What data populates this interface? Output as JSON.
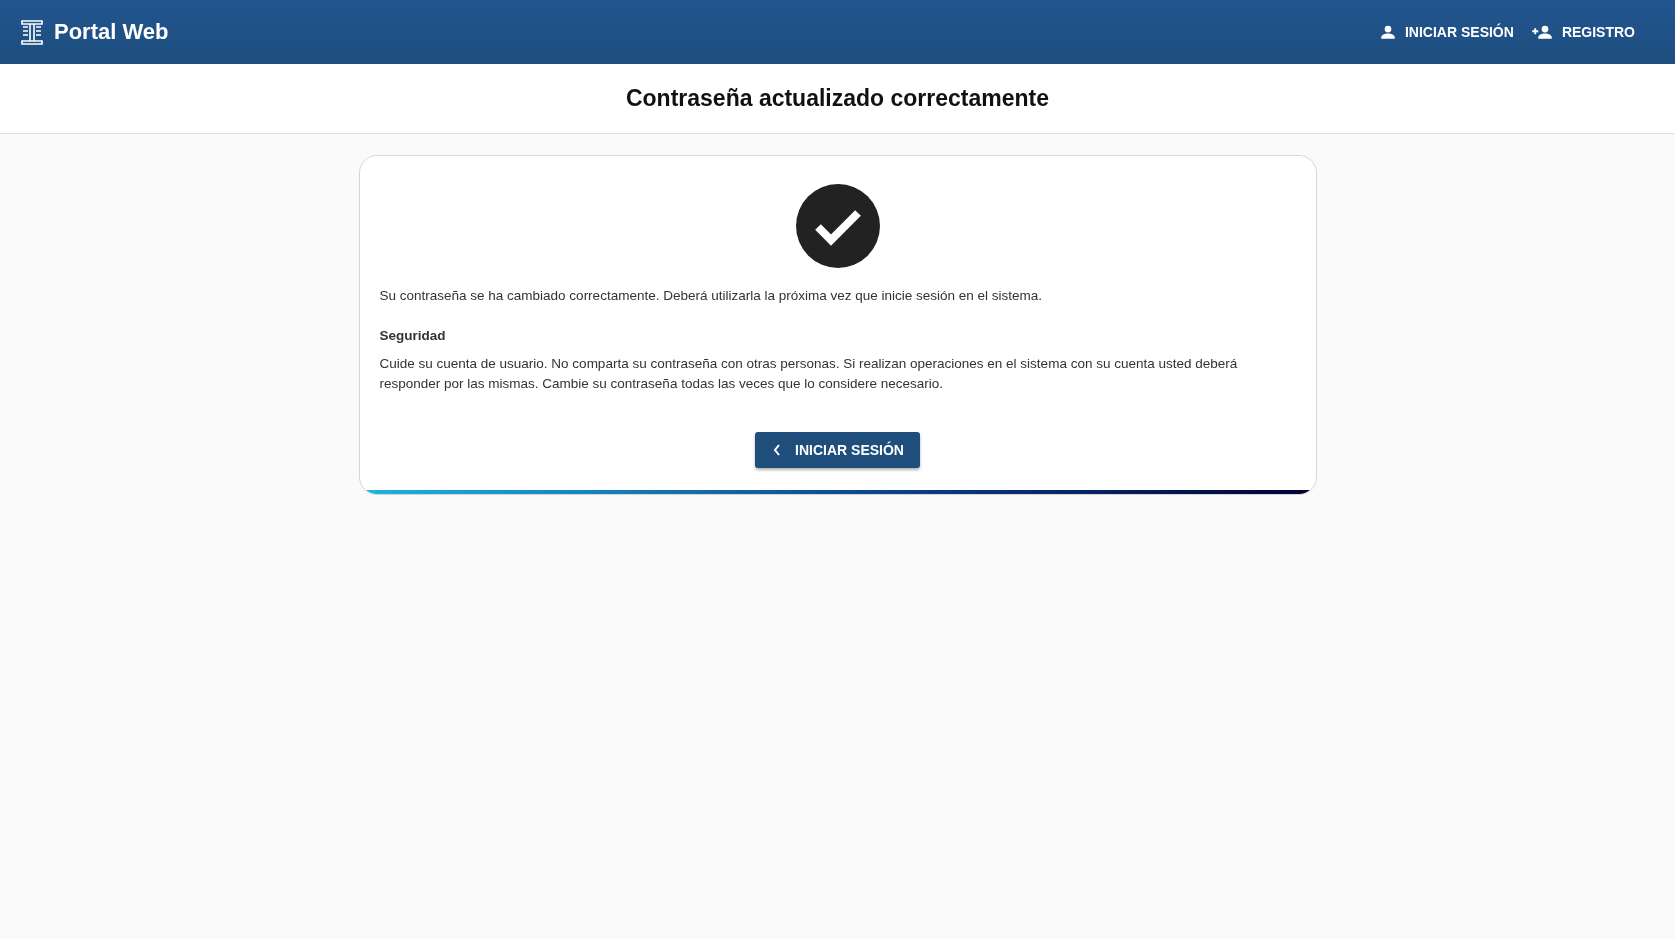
{
  "header": {
    "brand": "Portal Web",
    "nav": [
      {
        "label": "INICIAR SESIÓN",
        "kind": "login"
      },
      {
        "label": "REGISTRO",
        "kind": "register"
      }
    ]
  },
  "page_title": "Contraseña actualizado correctamente",
  "card": {
    "message": "Su contraseña se ha cambiado correctamente. Deberá utilizarla la próxima vez que inicie sesión en el sistema.",
    "section_title": "Seguridad",
    "section_text": "Cuide su cuenta de usuario. No comparta su contraseña con otras personas. Si realizan operaciones en el sistema con su cuenta usted deberá responder por las mismas. Cambie su contraseña todas las veces que lo considere necesario.",
    "button": "INICIAR SESIÓN"
  }
}
